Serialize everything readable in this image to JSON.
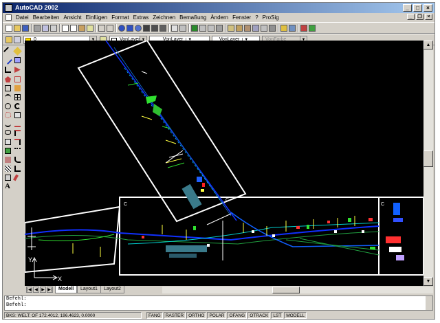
{
  "app": {
    "title": "AutoCAD 2002"
  },
  "menu": [
    "Datei",
    "Bearbeiten",
    "Ansicht",
    "Einfügen",
    "Format",
    "Extras",
    "Zeichnen",
    "Bemaßung",
    "Ändern",
    "Fenster",
    "?",
    "ProSig"
  ],
  "properties": {
    "layer_value": "0",
    "color_value": "VonLayer",
    "linetype_value": "VonLayer",
    "lineweight_value": "VonLayer",
    "plotstyle_value": "VonFarbe"
  },
  "tabs": {
    "model": "Modell",
    "layout1": "Layout1",
    "layout2": "Layout2"
  },
  "command": {
    "line1": "Befehl:",
    "line2": "Befehl:"
  },
  "status": {
    "coords": "BKS: WELT: OF  172.4012, 196.4623, 0.0000",
    "toggles": [
      "FANG",
      "RASTER",
      "ORTHO",
      "POLAR",
      "OFANG",
      "OTRACK",
      "LST",
      "MODELL"
    ]
  },
  "canvas": {
    "ucs_x": "X",
    "ucs_y": "Y",
    "sheet_markers": [
      "C",
      "C",
      "C"
    ]
  },
  "icons": {
    "window": [
      "minimize-icon",
      "maximize-icon",
      "close-icon"
    ],
    "left_tools": [
      "line",
      "construction-line",
      "polyline",
      "polygon",
      "rectangle",
      "arc",
      "circle",
      "revision-cloud",
      "spline",
      "ellipse",
      "insert-block",
      "make-block",
      "point",
      "hatch",
      "region",
      "multiline-text"
    ]
  },
  "colors": {
    "canvas_bg": "#000000",
    "title_start": "#0a246a",
    "title_end": "#a6caf0"
  }
}
